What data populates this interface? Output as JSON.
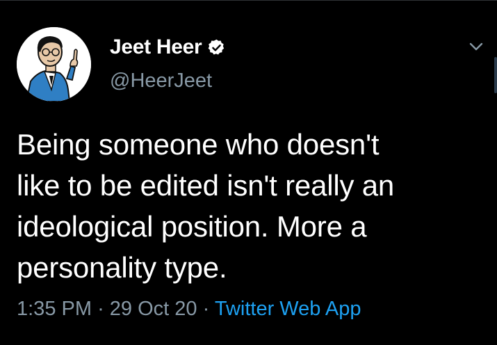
{
  "tweet": {
    "author": {
      "display_name": "Jeet Heer",
      "handle": "@HeerJeet",
      "verified": true,
      "avatar_icon": "cartoon-portrait-avatar"
    },
    "text": "Being someone who doesn't\nlike to be edited isn't really an\nideological position. More a\npersonality type.",
    "time": "1:35 PM",
    "date": "29 Oct 20",
    "separator": "·",
    "source": "Twitter Web App",
    "menu_icon": "chevron-down-icon"
  },
  "colors": {
    "background": "#000000",
    "primary_text": "#ffffff",
    "secondary_text": "#8899a6",
    "link": "#1da1f2",
    "verified_badge": "#ffffff"
  }
}
